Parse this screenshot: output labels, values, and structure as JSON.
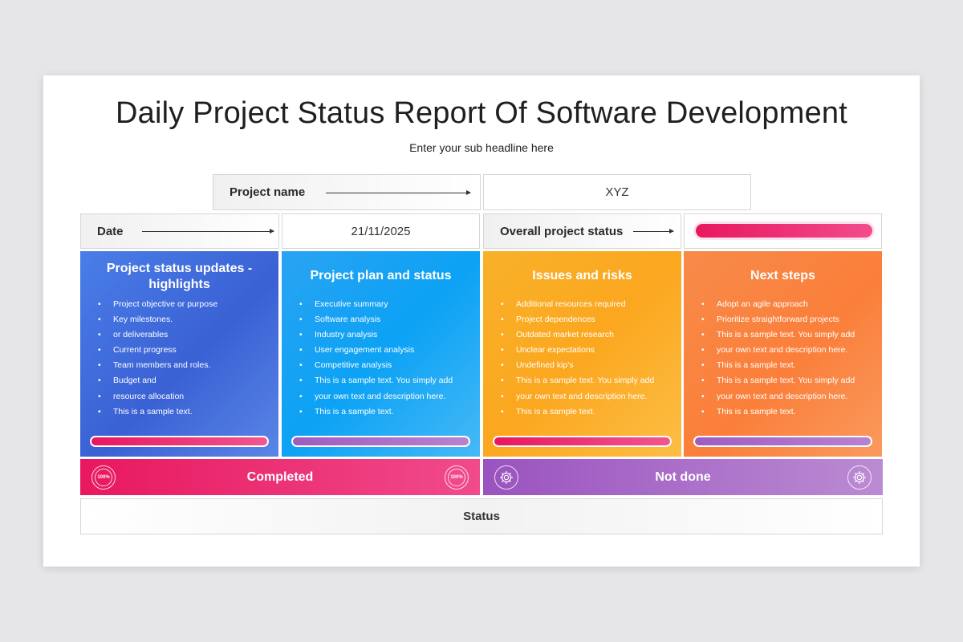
{
  "title": "Daily Project Status Report Of Software Development",
  "subtitle": "Enter your sub headline here",
  "info": {
    "project_name_label": "Project name",
    "project_name_value": "XYZ",
    "date_label": "Date",
    "date_value": "21/11/2025",
    "overall_status_label": "Overall project status",
    "overall_status_color": "#e8175f"
  },
  "panels": [
    {
      "title": "Project status updates - highlights",
      "items": [
        "Project objective or purpose",
        "Key milestones.",
        "or deliverables",
        "Current progress",
        "Team members and roles.",
        "Budget and",
        "resource allocation",
        "This is a sample text."
      ],
      "bar_color": "pink"
    },
    {
      "title": "Project plan and status",
      "items": [
        "Executive summary",
        "Software analysis",
        "Industry analysis",
        "User engagement analysis",
        "Competitive analysis",
        "This is a sample text. You simply add",
        "your own text and description here.",
        "This is a sample text."
      ],
      "bar_color": "purple"
    },
    {
      "title": "Issues and risks",
      "items": [
        "Additional resources required",
        "Project dependences",
        "Outdated market research",
        "Unclear expectations",
        "Undefined kip's",
        "This is a sample text. You simply add",
        "your own text and description here.",
        "This is a sample text."
      ],
      "bar_color": "pink"
    },
    {
      "title": "Next steps",
      "items": [
        "Adopt an agile approach",
        "Prioritize straightforward projects",
        "This is a sample text. You simply add",
        "your own text and description here.",
        "This is a sample text.",
        "This is a sample text. You simply add",
        "your own text and description here.",
        "This is a sample text."
      ],
      "bar_color": "purple"
    }
  ],
  "legend": {
    "completed_label": "Completed",
    "completed_badge": "100%",
    "completed_color": "#e8185f",
    "not_done_label": "Not done",
    "not_done_icon": "gear-icon",
    "not_done_color": "#9a53bf"
  },
  "status_label": "Status"
}
